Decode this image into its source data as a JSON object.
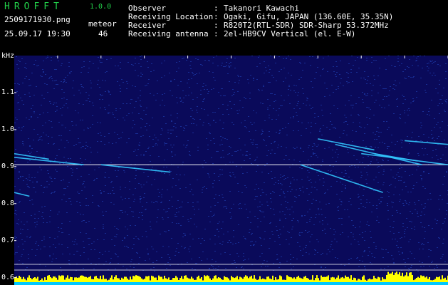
{
  "header": {
    "app_title": "HROFFT",
    "version": "1.0.0",
    "file_name": "2509171930.png",
    "timestamp": "25.09.17 19:30",
    "meteor_label": "meteor",
    "meteor_count": "46"
  },
  "info": [
    {
      "key": "Observer",
      "value": "Takanori Kawachi"
    },
    {
      "key": "Receiving Location",
      "value": "Ogaki, Gifu, JAPAN (136.60E, 35.35N)"
    },
    {
      "key": "Receiver",
      "value": "R820T2(RTL-SDR) SDR-Sharp 53.372MHz"
    },
    {
      "key": "Receiving antenna",
      "value": "2el-HB9CV Vertical (el. E-W)"
    }
  ],
  "colors": {
    "background": "#0a0a5a",
    "noise": "#1e3aa8",
    "carrier": "#ffffff",
    "trail": "#33c8ff",
    "bar": "#ffff00",
    "bar_base": "#00c8ff",
    "title": "#22d04a"
  },
  "chart_data": {
    "type": "spectrogram",
    "y_unit": "kHz",
    "x_ticks": [
      "1931",
      "1932",
      "1933",
      "1934",
      "1935",
      "1936",
      "1937",
      "1938",
      "1939",
      "1940"
    ],
    "y_ticks": [
      "1.1",
      "1.0",
      "0.9",
      "0.8",
      "0.7",
      "0.6"
    ],
    "x_range": [
      1930,
      1940
    ],
    "y_range": [
      0.58,
      1.2
    ],
    "carrier_khz": 0.905,
    "trails": [
      {
        "x": [
          1930.0,
          1930.8
        ],
        "y": [
          0.935,
          0.92
        ]
      },
      {
        "x": [
          1930.0,
          1931.6
        ],
        "y": [
          0.925,
          0.905
        ]
      },
      {
        "x": [
          1930.0,
          1930.35
        ],
        "y": [
          0.83,
          0.82
        ]
      },
      {
        "x": [
          1932.0,
          1933.6
        ],
        "y": [
          0.905,
          0.885
        ]
      },
      {
        "x": [
          1936.6,
          1938.5
        ],
        "y": [
          0.905,
          0.83
        ]
      },
      {
        "x": [
          1937.0,
          1938.3
        ],
        "y": [
          0.975,
          0.945
        ]
      },
      {
        "x": [
          1937.4,
          1939.4
        ],
        "y": [
          0.96,
          0.905
        ]
      },
      {
        "x": [
          1938.0,
          1940.0
        ],
        "y": [
          0.935,
          0.905
        ]
      },
      {
        "x": [
          1939.0,
          1940.0
        ],
        "y": [
          0.97,
          0.96
        ]
      },
      {
        "x": [
          1938.3,
          1939.3
        ],
        "y": [
          0.935,
          0.915
        ]
      }
    ]
  }
}
